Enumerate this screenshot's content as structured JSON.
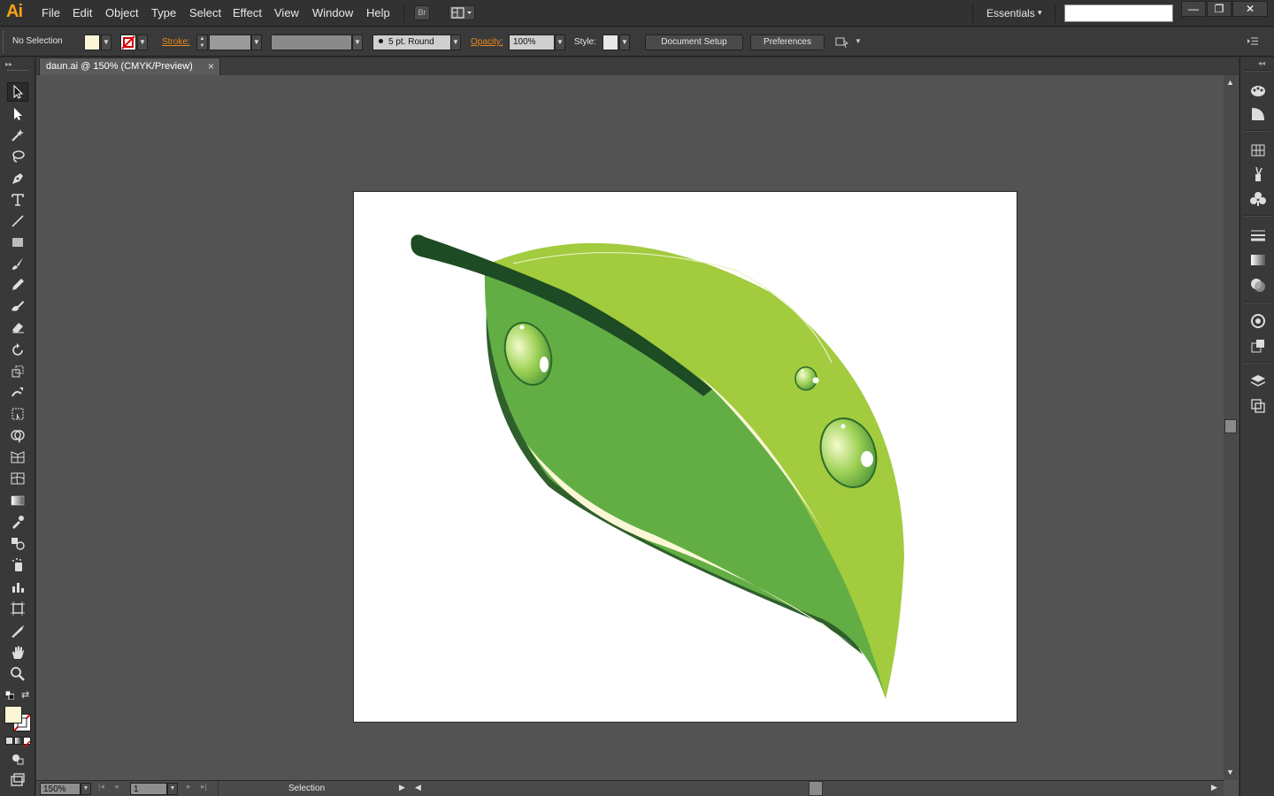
{
  "app": {
    "logo": "Ai"
  },
  "menu": [
    "File",
    "Edit",
    "Object",
    "Type",
    "Select",
    "Effect",
    "View",
    "Window",
    "Help"
  ],
  "bridge_label": "Br",
  "workspace": {
    "label": "Essentials",
    "arrow": "▾"
  },
  "search": {
    "value": ""
  },
  "window_controls": {
    "minimize": "—",
    "restore": "❐",
    "close": "✕"
  },
  "controlbar": {
    "selection_status": "No Selection",
    "stroke_label": "Stroke:",
    "brush": "5 pt. Round",
    "opacity_label": "Opacity:",
    "opacity_value": "100%",
    "style_label": "Style:",
    "document_setup": "Document Setup",
    "preferences": "Preferences"
  },
  "document": {
    "tab_title": "daun.ai @ 150% (CMYK/Preview)",
    "tab_close": "×"
  },
  "status": {
    "zoom": "150%",
    "artboard_number": "1",
    "tool": "Selection"
  },
  "colors": {
    "leaf_dark": "#2f5f2c",
    "leaf_mid": "#62ae44",
    "leaf_light": "#a2cb3e",
    "stem": "#1d4b23",
    "highlight": "#fbf7d6",
    "fill_swatch": "#fbf7d6",
    "accent": "#f7a21b"
  },
  "icons": {
    "tools": [
      "selection-tool",
      "direct-selection-tool",
      "magic-wand-tool",
      "lasso-tool",
      "pen-tool",
      "type-tool",
      "line-tool",
      "rectangle-tool",
      "paintbrush-tool",
      "pencil-tool",
      "blob-brush-tool",
      "eraser-tool",
      "rotate-tool",
      "scale-tool",
      "warp-tool",
      "free-transform-tool",
      "shape-builder-tool",
      "perspective-grid-tool",
      "mesh-tool",
      "gradient-tool",
      "eyedropper-tool",
      "blend-tool",
      "symbol-sprayer-tool",
      "column-graph-tool",
      "artboard-tool",
      "slice-tool",
      "hand-tool",
      "zoom-tool"
    ],
    "right_panels": [
      "color-panel",
      "color-guide-panel",
      "swatches-panel",
      "brushes-panel",
      "symbols-panel",
      "stroke-panel",
      "gradient-panel",
      "transparency-panel",
      "appearance-panel",
      "graphic-styles-panel",
      "layers-panel",
      "artboards-panel"
    ]
  }
}
